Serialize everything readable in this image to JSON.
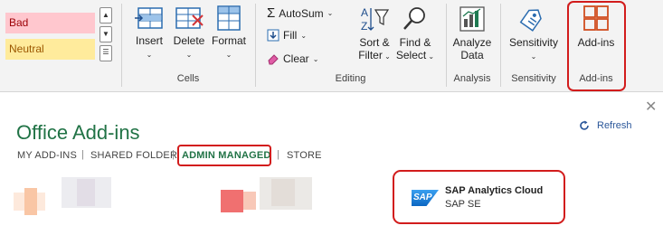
{
  "styles": {
    "bad": "Bad",
    "neutral": "Neutral"
  },
  "cells": {
    "insert": "Insert",
    "delete": "Delete",
    "format": "Format",
    "group_label": "Cells"
  },
  "editing": {
    "autosum": "AutoSum",
    "fill": "Fill",
    "clear": "Clear",
    "sort_filter_line1": "Sort &",
    "sort_filter_line2": "Filter",
    "find_select_line1": "Find &",
    "find_select_line2": "Select",
    "group_label": "Editing"
  },
  "analysis": {
    "analyze_line1": "Analyze",
    "analyze_line2": "Data",
    "group_label": "Analysis"
  },
  "sensitivity": {
    "button": "Sensitivity",
    "group_label": "Sensitivity"
  },
  "addins": {
    "button": "Add-ins",
    "group_label": "Add-ins"
  },
  "dialog": {
    "title": "Office Add-ins",
    "refresh": "Refresh",
    "tabs": [
      "MY ADD-INS",
      "SHARED FOLDER",
      "ADMIN MANAGED",
      "STORE"
    ],
    "separator": "|",
    "active_tab": "ADMIN MANAGED"
  },
  "addin_card": {
    "name": "SAP Analytics Cloud",
    "publisher": "SAP SE",
    "logo_text": "SAP"
  },
  "colors": {
    "accent_green": "#217346",
    "highlight_red": "#d21c1c",
    "link_blue": "#2b579a"
  }
}
